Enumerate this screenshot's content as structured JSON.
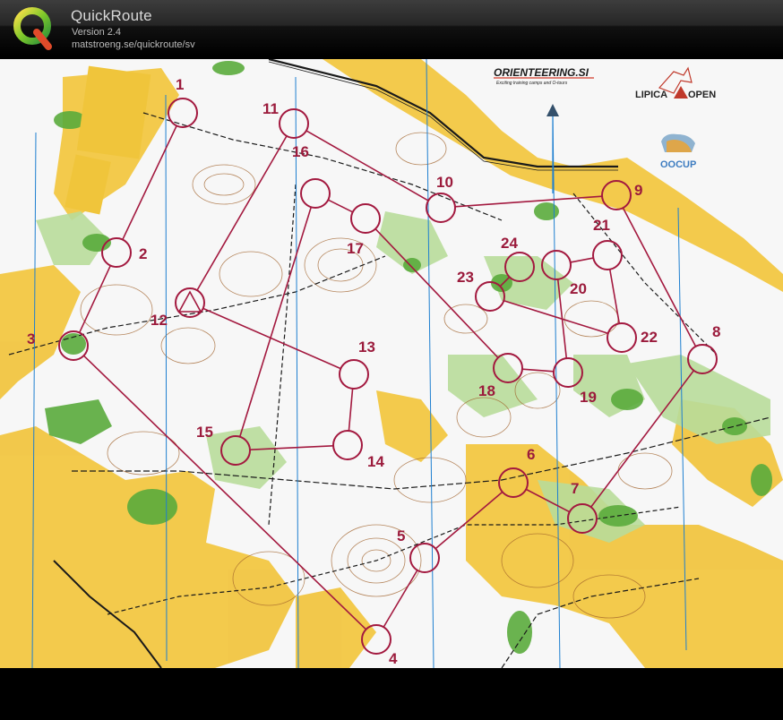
{
  "app": {
    "title": "QuickRoute",
    "version": "Version 2.4",
    "url": "matstroeng.se/quickroute/sv",
    "logo_letter": "Q"
  },
  "map": {
    "sponsor_orienteering": "ORIENTEERING.SI",
    "sponsor_orienteering_tagline": "Exciting training camps and O-tours",
    "sponsor_lipica": "LIPICA",
    "sponsor_open": "OPEN",
    "sponsor_oocup": "OOCUP",
    "colors": {
      "course": "#a3193f",
      "open_land": "#f2c53d",
      "forest_green": "#5aab3c",
      "light_green": "#b8dc9a",
      "contour": "#a0612a",
      "magnetic_north": "#1e7fd0"
    },
    "controls": [
      {
        "label": "1"
      },
      {
        "label": "2"
      },
      {
        "label": "3"
      },
      {
        "label": "4"
      },
      {
        "label": "5"
      },
      {
        "label": "6"
      },
      {
        "label": "7"
      },
      {
        "label": "8"
      },
      {
        "label": "9"
      },
      {
        "label": "10"
      },
      {
        "label": "11"
      },
      {
        "label": "12"
      },
      {
        "label": "13"
      },
      {
        "label": "14"
      },
      {
        "label": "15"
      },
      {
        "label": "16"
      },
      {
        "label": "17"
      },
      {
        "label": "18"
      },
      {
        "label": "19"
      },
      {
        "label": "20"
      },
      {
        "label": "21"
      },
      {
        "label": "22"
      },
      {
        "label": "23"
      },
      {
        "label": "24"
      }
    ]
  }
}
